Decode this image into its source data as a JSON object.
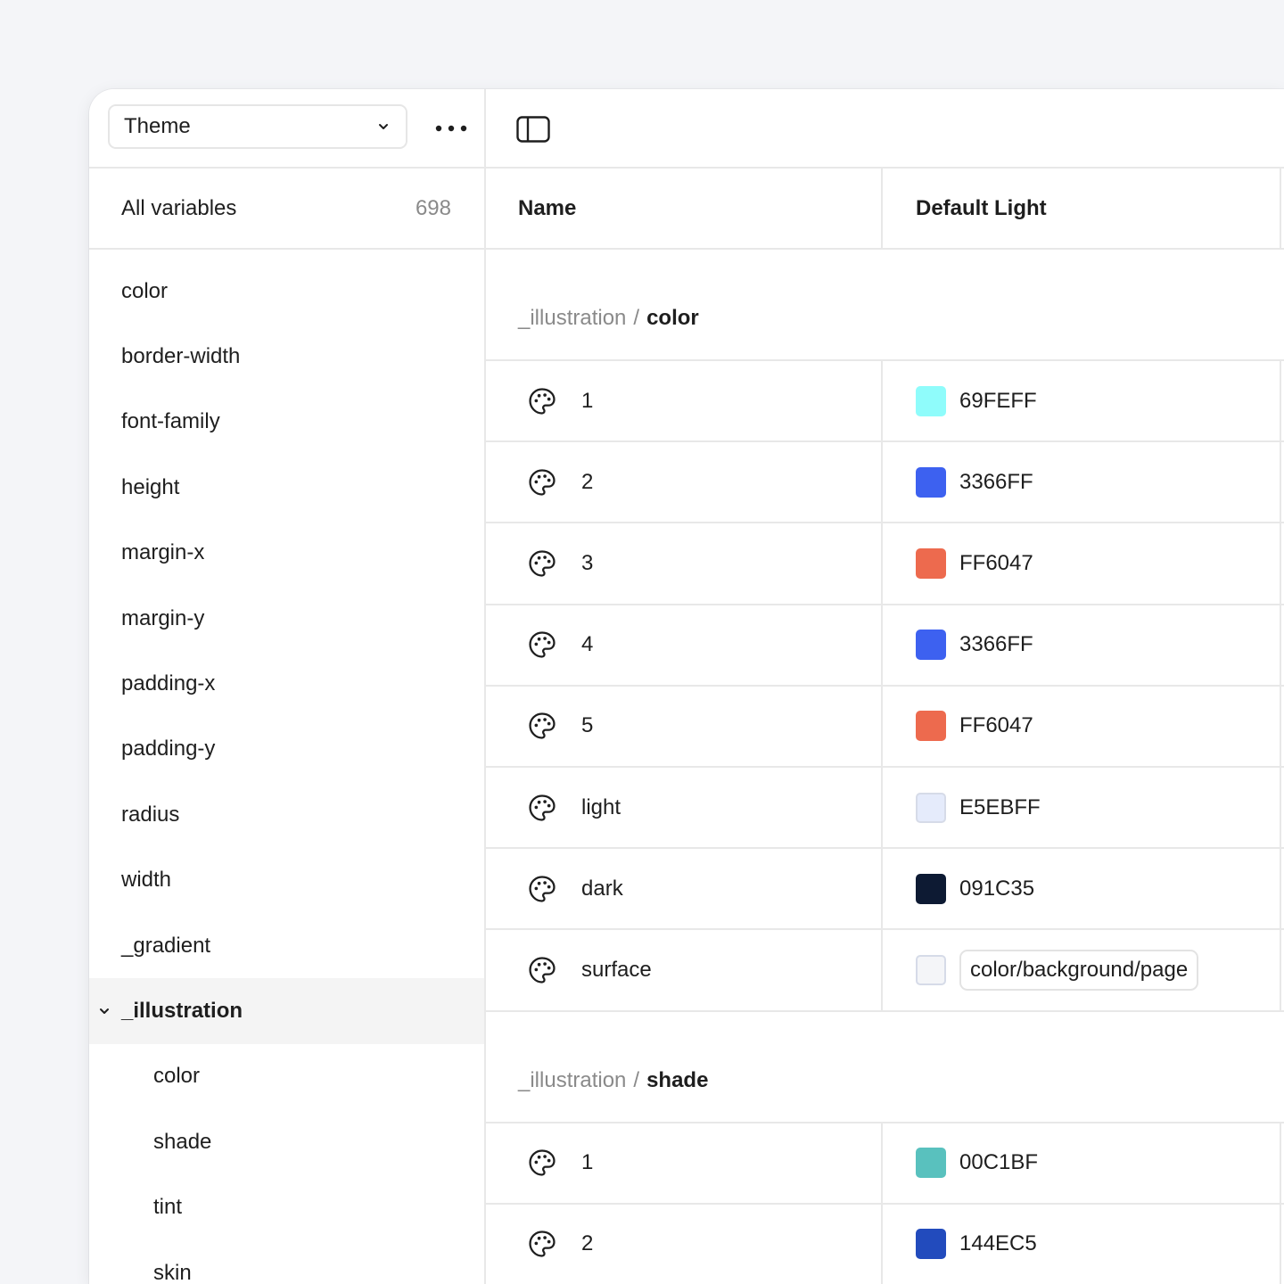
{
  "sidebar": {
    "collection": "Theme",
    "all_variables": {
      "label": "All variables",
      "count": "698"
    },
    "items": [
      {
        "label": "color"
      },
      {
        "label": "border-width"
      },
      {
        "label": "font-family"
      },
      {
        "label": "height"
      },
      {
        "label": "margin-x"
      },
      {
        "label": "margin-y"
      },
      {
        "label": "padding-x"
      },
      {
        "label": "padding-y"
      },
      {
        "label": "radius"
      },
      {
        "label": "width"
      },
      {
        "label": "_gradient"
      },
      {
        "label": "_illustration"
      },
      {
        "label": "color"
      },
      {
        "label": "shade"
      },
      {
        "label": "tint"
      },
      {
        "label": "skin"
      }
    ]
  },
  "table": {
    "headers": {
      "name": "Name",
      "mode": "Default Light"
    },
    "groups": [
      {
        "prefix": "_illustration",
        "separator": "/",
        "name": "color",
        "rows": [
          {
            "name": "1",
            "value": "69FEFF",
            "swatch": "#8ffcfb"
          },
          {
            "name": "2",
            "value": "3366FF",
            "swatch": "#3d61f0"
          },
          {
            "name": "3",
            "value": "FF6047",
            "swatch": "#ed6a4e"
          },
          {
            "name": "4",
            "value": "3366FF",
            "swatch": "#3d61f0"
          },
          {
            "name": "5",
            "value": "FF6047",
            "swatch": "#ed6a4e"
          },
          {
            "name": "light",
            "value": "E5EBFF",
            "swatch": "#e5ebfb"
          },
          {
            "name": "dark",
            "value": "091C35",
            "swatch": "#0d1a33"
          },
          {
            "name": "surface",
            "value": "color/background/page",
            "swatch": "#f4f5f8"
          }
        ]
      },
      {
        "prefix": "_illustration",
        "separator": "/",
        "name": "shade",
        "rows": [
          {
            "name": "1",
            "value": "00C1BF",
            "swatch": "#59c1be"
          },
          {
            "name": "2",
            "value": "144EC5",
            "swatch": "#224bbd"
          }
        ]
      }
    ]
  }
}
